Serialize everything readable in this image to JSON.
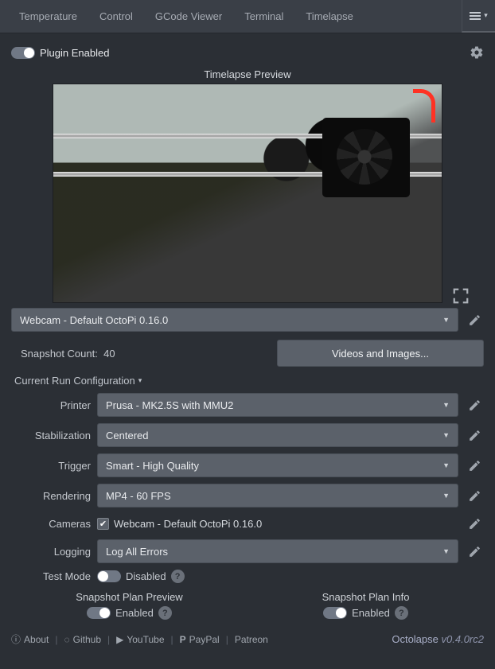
{
  "tabs": [
    "Temperature",
    "Control",
    "GCode Viewer",
    "Terminal",
    "Timelapse"
  ],
  "plugin_enabled_label": "Plugin Enabled",
  "plugin_enabled": true,
  "preview_title": "Timelapse Preview",
  "webcam_select": "Webcam - Default OctoPi 0.16.0",
  "snapshot_count_label": "Snapshot Count:",
  "snapshot_count_value": "40",
  "videos_images_btn": "Videos and Images...",
  "config_header": "Current Run Configuration",
  "form": {
    "printer": {
      "label": "Printer",
      "value": "Prusa - MK2.5S with MMU2"
    },
    "stabilization": {
      "label": "Stabilization",
      "value": "Centered"
    },
    "trigger": {
      "label": "Trigger",
      "value": "Smart - High Quality"
    },
    "rendering": {
      "label": "Rendering",
      "value": "MP4 - 60 FPS"
    },
    "cameras": {
      "label": "Cameras",
      "value": "Webcam - Default OctoPi 0.16.0",
      "checked": true
    },
    "logging": {
      "label": "Logging",
      "value": "Log All Errors"
    },
    "test_mode": {
      "label": "Test Mode",
      "value": "Disabled",
      "enabled": false
    }
  },
  "snapshot_plan_preview": {
    "title": "Snapshot Plan Preview",
    "state": "Enabled",
    "enabled": true
  },
  "snapshot_plan_info": {
    "title": "Snapshot Plan Info",
    "state": "Enabled",
    "enabled": true
  },
  "footer": {
    "links": {
      "about": "About",
      "github": "Github",
      "youtube": "YouTube",
      "paypal": "PayPal",
      "patreon": "Patreon"
    },
    "brand": "Octolapse",
    "version": "v0.4.0rc2"
  }
}
